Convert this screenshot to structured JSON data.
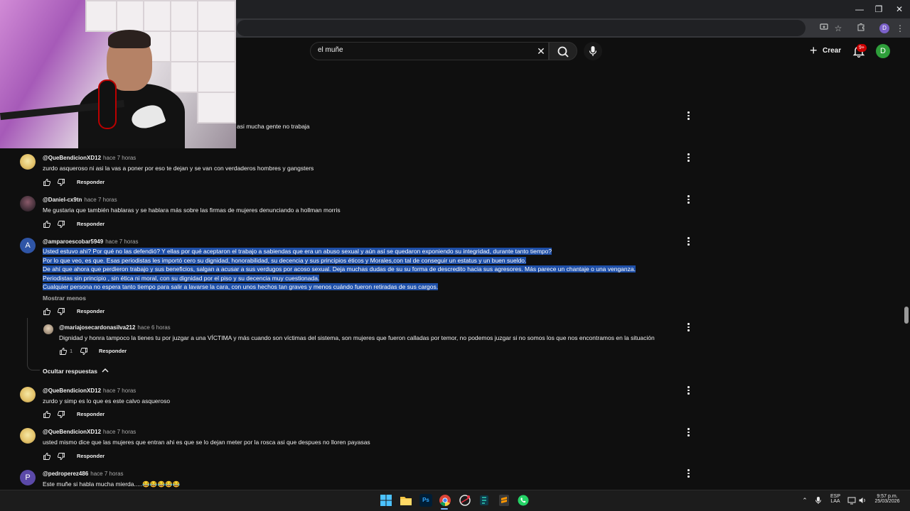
{
  "search": {
    "query": "el muñe"
  },
  "header": {
    "create_label": "Crear",
    "notifications_badge": "9+",
    "avatar_letter": "D"
  },
  "browser": {
    "profile_letter": "D"
  },
  "comments": [
    {
      "text": "asi mucha gente no trabaja"
    },
    {
      "author": "@QueBendicionXD12",
      "time": "hace 7 horas",
      "text": "zurdo asqueroso ni asi la vas a poner por eso te dejan y se van con verdaderos hombres y gangsters",
      "reply": "Responder"
    },
    {
      "author": "@Daniel-cx9tn",
      "time": "hace 7 horas",
      "text": "Me gustaria que también hablaras y se hablara más sobre las firmas de mujeres denunciando a hollman morris",
      "reply": "Responder"
    },
    {
      "author": "@amparoescobar5949",
      "time": "hace 7 horas",
      "avatar_letter": "A",
      "lines": [
        "Usted estuvo ahi? Por qué no las defendió? Y ellas por qué aceptaron el trabajo a sabiendas que era un abuso sexual y aún así se quedaron exponiendo su integridad, durante tanto tiempo?",
        "Por lo que veo, es que. Esas periodistas les importó cero su dignidad, honorabilidad, su decencia y sus principios éticos y Morales,con tal de conseguir un estatus y un buen sueldo.",
        " De ahí que ahora que perdieron trabajo y sus beneficios, salgan a acusar a sus verdugos por acoso sexual. Deja muchas dudas de su su forma de descredito hacia sus agresores. Más parece un chantaje o una venganza.",
        "Periodistas sin principio , sin ética ni moral, con su dignidad por el piso y su decencia muy cuestionada.",
        " Cualquier persona no espera tanto tiempo para salir a lavarse la cara, con unos hechos tan graves y menos cuándo fueron retiradas de sus cargos."
      ],
      "show_less": "Mostrar menos",
      "reply": "Responder"
    },
    {
      "author": "@mariajosecardonasilva212",
      "time": "hace 6 horas",
      "text": "Dignidad y honra tampoco la tienes tu por juzgar a una VÍCTIMA y más cuando son víctimas del sistema, son mujeres que fueron calladas por temor,  no podemos juzgar si no somos los que nos encontramos en la situación",
      "likes": "1",
      "reply": "Responder"
    },
    {
      "author": "@QueBendicionXD12",
      "time": "hace 7 horas",
      "text": "zurdo y simp es lo que es este calvo asqueroso",
      "reply": "Responder"
    },
    {
      "author": "@QueBendicionXD12",
      "time": "hace 7 horas",
      "text": "usted mismo dice que las mujeres que entran ahi es que se lo dejan meter por la rosca asi que despues no lloren payasas",
      "reply": "Responder"
    },
    {
      "author": "@pedroperez486",
      "time": "hace 7 horas",
      "avatar_letter": "P",
      "text": "Este muñe si habla mucha mierda.....😂😂😂😂😂"
    }
  ],
  "hide_replies": "Ocultar respuestas",
  "taskbar": {
    "lang_line1": "ESP",
    "lang_line2": "LAA",
    "time": "9:57 p.m.",
    "date": "25/03/2026"
  },
  "colors": {
    "background": "#0f0f0f",
    "selection": "#1e4fa8",
    "text": "#f1f1f1",
    "secondary": "#aaaaaa",
    "notification": "#cc0000"
  }
}
